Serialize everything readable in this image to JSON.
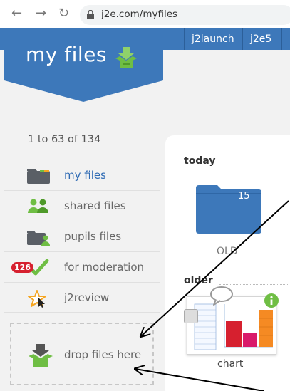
{
  "browser": {
    "url": "j2e.com/myfiles",
    "icons": [
      "back-arrow-icon",
      "forward-arrow-icon",
      "reload-icon",
      "lock-icon"
    ]
  },
  "topnav": {
    "tabs": [
      {
        "label": "j2launch"
      },
      {
        "label": "j2e5"
      }
    ]
  },
  "banner": {
    "title": "my files",
    "icon": "download-box-icon"
  },
  "sidebar": {
    "count_text": "1 to 63 of 134",
    "items": [
      {
        "label": "my files",
        "icon": "folder-icon",
        "active": true
      },
      {
        "label": "shared files",
        "icon": "people-icon"
      },
      {
        "label": "pupils files",
        "icon": "pupils-folder-icon"
      },
      {
        "label": "for moderation",
        "icon": "checkmark-icon",
        "badge": "126"
      },
      {
        "label": "j2review",
        "icon": "star-cursor-icon"
      }
    ],
    "dropzone": {
      "label": "drop files here",
      "icon": "download-box-icon"
    }
  },
  "main": {
    "sections": [
      {
        "title": "today"
      },
      {
        "title": "older"
      }
    ],
    "folder": {
      "name": "OLD",
      "count": "15"
    },
    "file": {
      "name": "chart"
    }
  },
  "colors": {
    "brand_blue": "#3d78ba",
    "green": "#6fbe44",
    "badge_red": "#d6202f",
    "active_text": "#2f6bb4"
  }
}
